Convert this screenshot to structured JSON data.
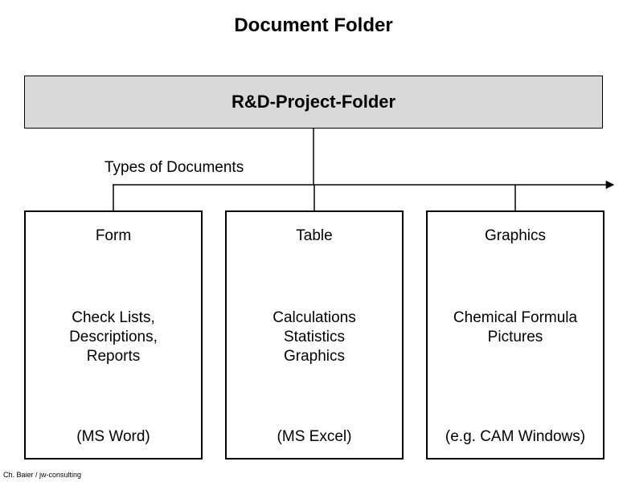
{
  "title": "Document Folder",
  "root_box": "R&D-Project-Folder",
  "section_label": "Types of Documents",
  "columns": [
    {
      "head": "Form",
      "mid": "Check Lists,\nDescriptions,\nReports",
      "foot": "(MS Word)"
    },
    {
      "head": "Table",
      "mid": "Calculations\nStatistics\nGraphics",
      "foot": "(MS Excel)"
    },
    {
      "head": "Graphics",
      "mid": "Chemical Formula\nPictures",
      "foot": "(e.g. CAM Windows)"
    }
  ],
  "footer": "Ch. Baier / jw-consulting"
}
